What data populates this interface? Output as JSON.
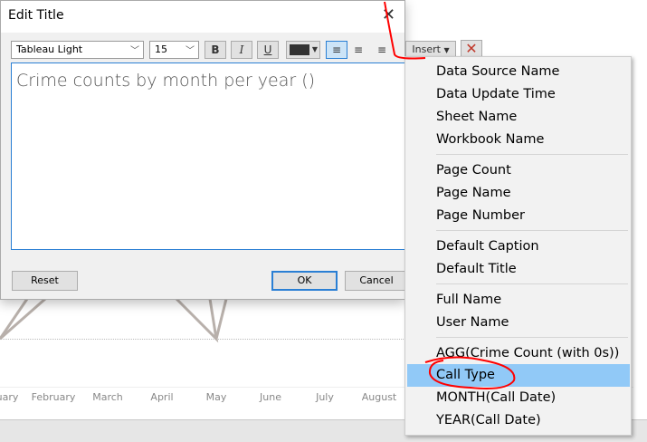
{
  "dialog": {
    "title": "Edit Title",
    "font": "Tableau Light",
    "size": "15",
    "bold": "B",
    "italic": "I",
    "underline": "U",
    "insert": "Insert",
    "text": "Crime counts by month per year ()",
    "reset": "Reset",
    "ok": "OK",
    "cancel": "Cancel"
  },
  "menu": {
    "items": [
      "Data Source Name",
      "Data Update Time",
      "Sheet Name",
      "Workbook Name",
      "Page Count",
      "Page Name",
      "Page Number",
      "Default Caption",
      "Default Title",
      "Full Name",
      "User Name",
      "AGG(Crime Count (with 0s))",
      "Call Type",
      "MONTH(Call Date)",
      "YEAR(Call Date)"
    ],
    "highlighted": "Call Type"
  },
  "chart": {
    "months": [
      "uary",
      "February",
      "March",
      "April",
      "May",
      "June",
      "July",
      "August"
    ]
  },
  "colors": {
    "highlight": "#91c9f7",
    "annotation": "#ff0000",
    "focus": "#2a7fd4"
  }
}
